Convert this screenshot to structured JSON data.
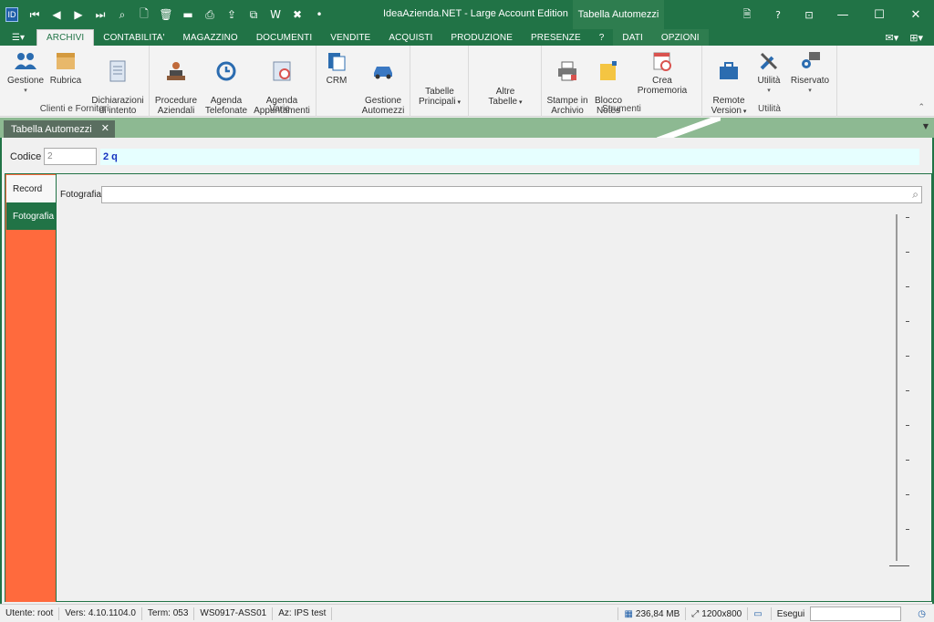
{
  "window": {
    "title": "IdeaAzienda.NET - Large Account Edition",
    "context_title": "Tabella Automezzi"
  },
  "quick_access": [
    "first-icon",
    "prev-icon",
    "next-icon",
    "last-icon",
    "search-icon",
    "new-icon",
    "delete-icon",
    "open-icon",
    "print-icon",
    "export-icon",
    "copy-icon",
    "word-icon",
    "excel-icon",
    "pin-icon"
  ],
  "window_controls": {
    "doc": "🗎",
    "help": "?",
    "restore": "⊡",
    "minimize": "—",
    "maximize": "☐",
    "close": "✕"
  },
  "ribbon_tabs": [
    {
      "label": "ARCHIVI",
      "active": true
    },
    {
      "label": "CONTABILITA'"
    },
    {
      "label": "MAGAZZINO"
    },
    {
      "label": "DOCUMENTI"
    },
    {
      "label": "VENDITE"
    },
    {
      "label": "ACQUISTI"
    },
    {
      "label": "PRODUZIONE"
    },
    {
      "label": "PRESENZE"
    },
    {
      "label": "?"
    }
  ],
  "context_tabs": [
    {
      "label": "DATI"
    },
    {
      "label": "OPZIONI"
    }
  ],
  "ribbon": {
    "groups": {
      "clienti": "Clienti e Fornitori",
      "varie": "Varie",
      "strumenti": "Strumenti",
      "utilita": "Utilità"
    },
    "buttons": {
      "gestione": "Gestione",
      "rubrica": "Rubrica",
      "dichiarazioni": "Dichiarazioni\ndi intento",
      "procedure": "Procedure\nAziendali",
      "agenda_tel": "Agenda\nTelefonate",
      "agenda_app": "Agenda\nAppuntamenti",
      "crm": "CRM",
      "gestione_automezzi": "Gestione\nAutomezzi",
      "tabelle_principali": "Tabelle\nPrincipali",
      "altre_tabelle": "Altre\nTabelle",
      "stampe": "Stampe in\nArchivio",
      "blocco_note": "Blocco\nNotes",
      "promemoria": "Crea Promemoria",
      "remote": "Remote\nVersion",
      "utilita": "Utilità",
      "riservato": "Riservato"
    }
  },
  "doc_tab": {
    "label": "Tabella Automezzi",
    "close": "✕"
  },
  "form": {
    "codice_label": "Codice",
    "codice_value": "2",
    "codice_display": "2 q",
    "tabs": {
      "record": "Record",
      "fotografia": "Fotografia"
    },
    "fotografia_label": "Fotografia",
    "fotografia_value": ""
  },
  "statusbar": {
    "utente": "Utente: root",
    "versione": "Vers: 4.10.1104.0",
    "terminale": "Term: 053",
    "workstation": "WS0917-ASS01",
    "azienda": "Az: IPS test",
    "memoria": "236,84 MB",
    "risoluzione": "1200x800",
    "esegui_label": "Esegui",
    "esegui_value": ""
  },
  "colors": {
    "accent": "#217346",
    "left_tab_bg": "#ff6a3d",
    "codice_display_bg": "#e6ffff",
    "codice_display_text": "#1432c0"
  }
}
